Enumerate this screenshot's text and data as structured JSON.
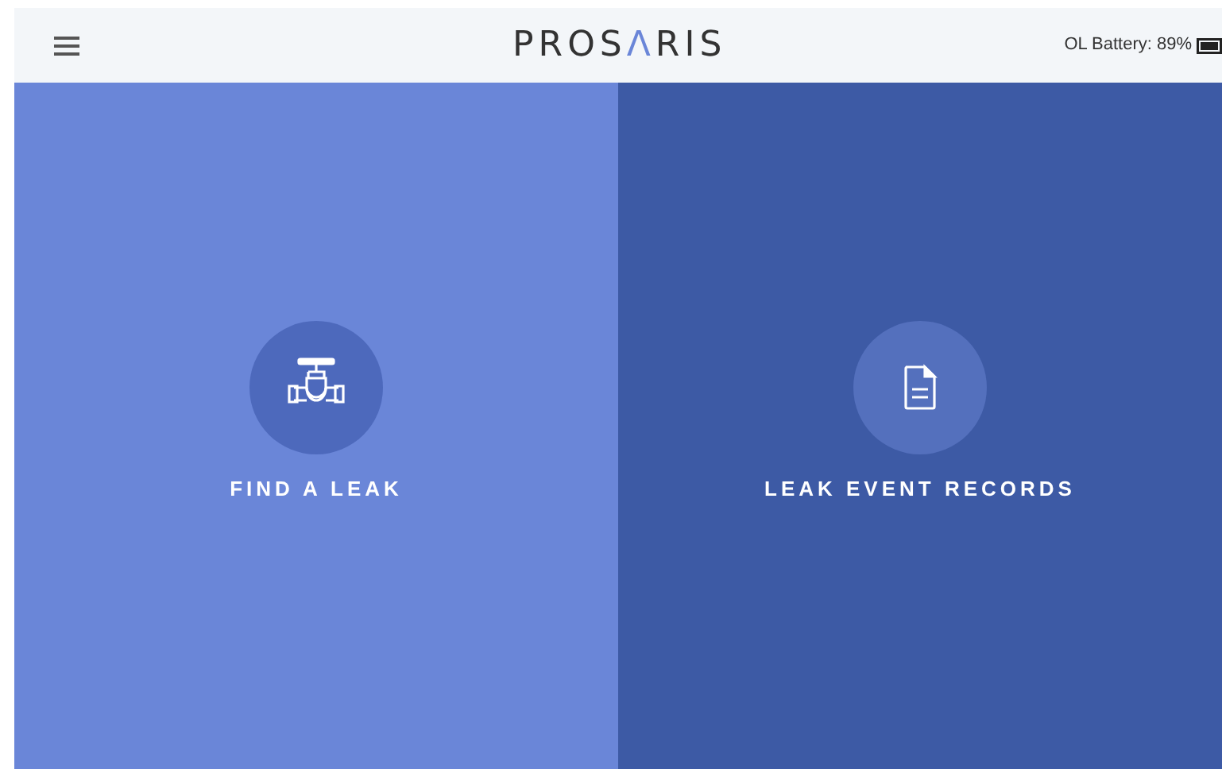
{
  "header": {
    "logo": "PROSΛRIS",
    "battery": "OL Battery: 89%"
  },
  "tiles": [
    {
      "kind": "valve",
      "label": "FIND A LEAK"
    },
    {
      "kind": "document",
      "label": "LEAK EVENT RECORDS"
    }
  ]
}
